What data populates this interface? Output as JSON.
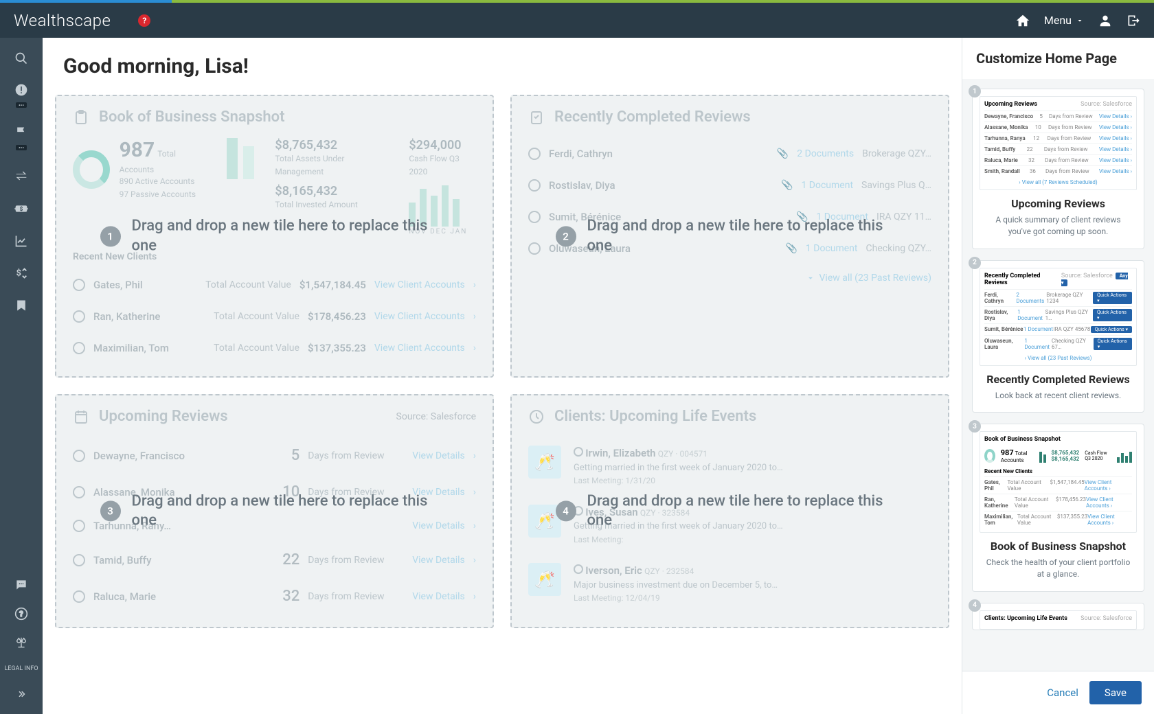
{
  "brand": "Wealthscape",
  "top": {
    "menu_label": "Menu"
  },
  "greeting": "Good morning, Lisa!",
  "drop_hint": "Drag and drop a new tile here to replace this one",
  "tiles": {
    "book": {
      "title": "Book of Business Snapshot",
      "total_accounts_num": "987",
      "total_accounts_label": "Total Accounts",
      "active": "890 Active Accounts",
      "passive": "97 Passive Accounts",
      "assets_amt": "$8,765,432",
      "assets_label": "Total Assets Under Management",
      "invested_amt": "$8,165,432",
      "invested_label": "Total Invested Amount",
      "cashflow_amt": "$294,000",
      "cashflow_label": "Cash Flow Q3 2020",
      "months": "NOV  DEC  JAN",
      "recent_label": "Recent New Clients",
      "clients": [
        {
          "name": "Gates, Phil",
          "meta": "Total Account Value",
          "val": "$1,547,184.45",
          "link": "View Client Accounts"
        },
        {
          "name": "Ran, Katherine",
          "meta": "Total Account Value",
          "val": "$178,456.23",
          "link": "View Client Accounts"
        },
        {
          "name": "Maximilian, Tom",
          "meta": "Total Account Value",
          "val": "$137,355.23",
          "link": "View Client Accounts"
        }
      ]
    },
    "completed": {
      "title": "Recently Completed Reviews",
      "rows": [
        {
          "name": "Ferdi, Cathryn",
          "docs": "2 Documents",
          "acct": "Brokerage QZY…"
        },
        {
          "name": "Rostislav, Diya",
          "docs": "1 Document",
          "acct": "Savings Plus Q…"
        },
        {
          "name": "Sumit, Bérénice",
          "docs": "1 Document",
          "acct": "IRA QZY 11…"
        },
        {
          "name": "Oluwaseun, Laura",
          "docs": "1 Document",
          "acct": "Checking QZY…"
        }
      ],
      "view_all": "View all (23 Past Reviews)"
    },
    "upcoming": {
      "title": "Upcoming Reviews",
      "source": "Source: Salesforce",
      "rows": [
        {
          "name": "Dewayne, Francisco",
          "days": "5",
          "label": "Days from Review",
          "link": "View Details"
        },
        {
          "name": "Alassane, Monika",
          "days": "10",
          "label": "Days from Review",
          "link": "View Details"
        },
        {
          "name": "Tarhunna, Rany…",
          "days": "",
          "label": "",
          "link": "View Details"
        },
        {
          "name": "Tamid, Buffy",
          "days": "22",
          "label": "Days from Review",
          "link": "View Details"
        },
        {
          "name": "Raluca, Marie",
          "days": "32",
          "label": "Days from Review",
          "link": "View Details"
        }
      ]
    },
    "events": {
      "title": "Clients: Upcoming Life Events",
      "rows": [
        {
          "name": "Irwin, Elizabeth",
          "id": "QZY · 004571",
          "desc": "Getting married in the first week of January 2020 to…",
          "meta": "Last Meeting: 1/31/20"
        },
        {
          "name": "Ives, Susan",
          "id": "QZY · 323584",
          "desc": "Getting married in the first week of January 2020 to…",
          "meta": "Last Meeting:"
        },
        {
          "name": "Iverson, Eric",
          "id": "QZY · 232584",
          "desc": "Major business investment due on December 5, to…",
          "meta": "Last Meeting: 12/04/19"
        }
      ]
    }
  },
  "panel": {
    "title": "Customize Home Page",
    "cards": [
      {
        "num": "1",
        "title": "Upcoming Reviews",
        "desc": "A quick summary of client reviews you've got coming up soon.",
        "thumb_title": "Upcoming Reviews",
        "thumb_src": "Source: Salesforce",
        "rows": [
          {
            "a": "Dewayne, Francisco",
            "b": "5",
            "c": "Days from Review",
            "d": "View Details ›"
          },
          {
            "a": "Alassane, Monika",
            "b": "10",
            "c": "Days from Review",
            "d": "View Details ›"
          },
          {
            "a": "Tarhunna, Ranya",
            "b": "12",
            "c": "Days from Review",
            "d": "View Details ›"
          },
          {
            "a": "Tamid, Buffy",
            "b": "22",
            "c": "Days from Review",
            "d": "View Details ›"
          },
          {
            "a": "Raluca, Marie",
            "b": "32",
            "c": "Days from Review",
            "d": "View Details ›"
          },
          {
            "a": "Smith, Randall",
            "b": "36",
            "c": "Days from Review",
            "d": "View Details ›"
          }
        ],
        "footer": "› View all (7 Reviews Scheduled)"
      },
      {
        "num": "2",
        "title": "Recently Completed Reviews",
        "desc": "Look back at recent client reviews.",
        "thumb_title": "Recently Completed Reviews",
        "thumb_src": "Source: Salesforce",
        "rows": [
          {
            "a": "Ferdi, Cathryn",
            "b": "2 Documents",
            "c": "Brokerage QZY 1234",
            "d": "Quick Actions ▾"
          },
          {
            "a": "Rostislav, Diya",
            "b": "1 Document",
            "c": "Savings Plus QZY 1…",
            "d": "Quick Actions ▾"
          },
          {
            "a": "Sumit, Bérénice",
            "b": "1 Document",
            "c": "IRA QZY 45678",
            "d": "Quick Actions ▾"
          },
          {
            "a": "Oluwaseun, Laura",
            "b": "1 Document",
            "c": "Checking QZY 67…",
            "d": "Quick Actions ▾"
          }
        ],
        "footer": "› View all (23 Past Reviews)"
      },
      {
        "num": "3",
        "title": "Book of Business Snapshot",
        "desc": "Check the health of your client portfolio at a glance.",
        "thumb_title": "Book of Business Snapshot",
        "stats": {
          "n": "987",
          "l": "Total Accounts",
          "a1": "$8,765,432",
          "a2": "$8,165,432",
          "cf": "Cash Flow Q3 2020"
        },
        "sect": "Recent New Clients",
        "rows": [
          {
            "a": "Gates, Phil",
            "b": "Total Account Value",
            "c": "$1,547,184.45",
            "d": "View Client Accounts ›"
          },
          {
            "a": "Ran, Katherine",
            "b": "Total Account Value",
            "c": "$178,456.23",
            "d": "View Client Accounts ›"
          },
          {
            "a": "Maximilian, Tom",
            "b": "Total Account Value",
            "c": "$137,355.23",
            "d": "View Client Accounts ›"
          }
        ]
      },
      {
        "num": "4",
        "title_only": "Clients: Upcoming Life Events",
        "thumb_src": "Source: Salesforce"
      }
    ],
    "cancel": "Cancel",
    "save": "Save"
  },
  "legal": "LEGAL INFO"
}
